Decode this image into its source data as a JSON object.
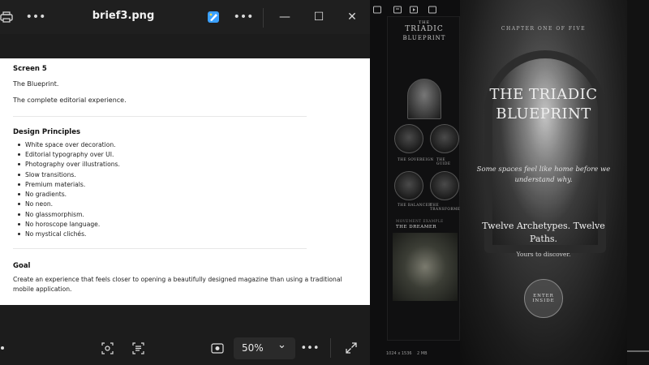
{
  "viewer": {
    "title": "brief3.png",
    "more1": "•••",
    "more2": "•••",
    "minimize": "—",
    "maximize": "☐",
    "close": "✕"
  },
  "document": {
    "screen": "Screen 5",
    "screen_title": "The Blueprint.",
    "screen_subtitle": "The complete editorial experience.",
    "principles_heading": "Design Principles",
    "principles": [
      "White space over decoration.",
      "Editorial typography over UI.",
      "Photography over illustrations.",
      "Slow transitions.",
      "Premium materials.",
      "No gradients.",
      "No neon.",
      "No glassmorphism.",
      "No horoscope language.",
      "No mystical clichés."
    ],
    "goal_heading": "Goal",
    "goal_line1": "Create an experience that feels closer to opening a beautifully designed magazine than using a traditional",
    "goal_line2": "mobile application."
  },
  "bottombar": {
    "zoom_value": "50%",
    "zoom_chevron": "⌄",
    "more": "•••"
  },
  "preview_strip": {
    "title_small": "THE",
    "title1": "TRIADIC",
    "title2": "BLUEPRINT",
    "label1": "THE SOVEREIGN",
    "label2": "THE GUIDE",
    "label3": "THE BALANCER",
    "label4": "THE TRANSFORMER",
    "feature_kicker": "MOVEMENT EXAMPLE",
    "feature": "THE DREAMER",
    "file_info": "1024 x 1536",
    "file_size": "2 MB"
  },
  "poster": {
    "chapter": "CHAPTER ONE OF FIVE",
    "title1": "THE TRIADIC",
    "title2": "BLUEPRINT",
    "tagline1": "Some spaces feel like home before we",
    "tagline2": "understand why.",
    "headline1": "Twelve Archetypes. Twelve",
    "headline2": "Paths.",
    "sub": "Yours to discover.",
    "seal1": "ENTER",
    "seal2": "INSIDE"
  },
  "colors": {
    "viewer_bg": "#1c1c1c",
    "document_bg": "#ffffff",
    "accent_icon": "#3aa0ff"
  }
}
